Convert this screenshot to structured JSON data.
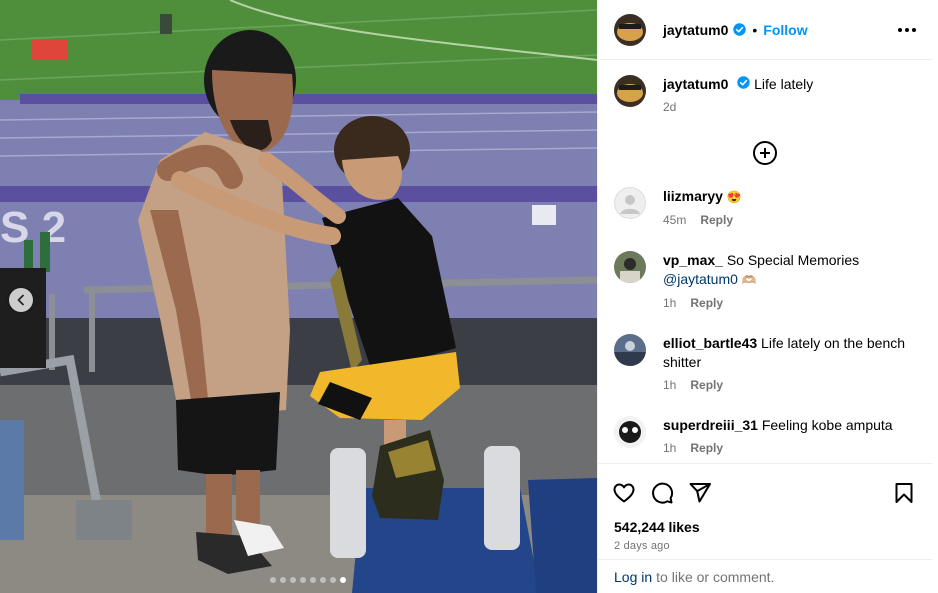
{
  "post": {
    "author": "jaytatum0",
    "follow_label": "Follow",
    "separator": "•",
    "caption": {
      "username": "jaytatum0",
      "text": "Life lately",
      "age": "2d"
    },
    "carousel": {
      "slide_count": 8,
      "active_index": 7
    },
    "comments": [
      {
        "username": "liizmaryy",
        "text": "😍",
        "age": "45m",
        "reply_label": "Reply"
      },
      {
        "username": "vp_max_",
        "text": "So Special Memories",
        "mention": "@jaytatum0",
        "trail": "🫶🏼",
        "age": "1h",
        "reply_label": "Reply"
      },
      {
        "username": "elliot_bartle43",
        "text": "Life lately on the bench shitter",
        "age": "1h",
        "reply_label": "Reply"
      },
      {
        "username": "superdreiii_31",
        "text": "Feeling kobe amputa",
        "age": "1h",
        "reply_label": "Reply"
      }
    ],
    "likes": "542,244 likes",
    "date": "2 days ago",
    "login": {
      "link": "Log in",
      "rest": "to like or comment."
    }
  },
  "icons": {
    "verified": "verified-badge-icon",
    "more": "more-options-icon",
    "add_comment": "plus-circle-icon",
    "like": "heart-icon",
    "comment": "comment-bubble-icon",
    "share": "paper-plane-icon",
    "save": "bookmark-icon",
    "prev": "chevron-left-icon"
  },
  "colors": {
    "accent": "#0095f6",
    "verified": "#0095f6",
    "link": "#00376b",
    "muted": "#737373"
  }
}
